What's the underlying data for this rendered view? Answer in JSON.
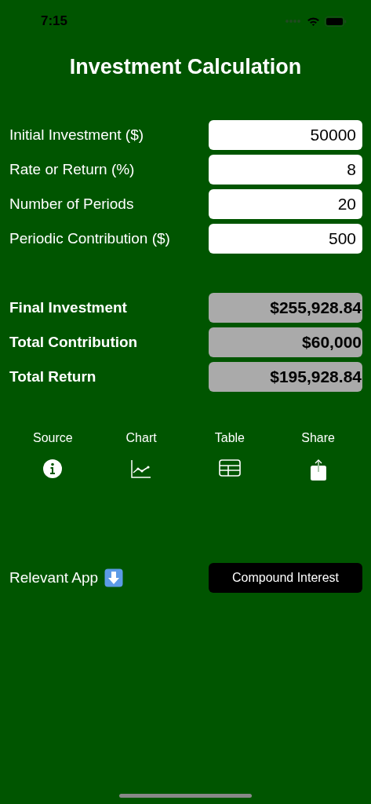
{
  "status_bar": {
    "time": "7:15"
  },
  "title": "Investment Calculation",
  "inputs": [
    {
      "label": "Initial Investment ($)",
      "value": "50000"
    },
    {
      "label": "Rate or Return (%)",
      "value": "8"
    },
    {
      "label": "Number of Periods",
      "value": "20"
    },
    {
      "label": "Periodic Contribution ($)",
      "value": "500"
    }
  ],
  "results": [
    {
      "label": "Final Investment",
      "value": "$255,928.84"
    },
    {
      "label": "Total Contribution",
      "value": "$60,000"
    },
    {
      "label": "Total Return",
      "value": "$195,928.84"
    }
  ],
  "actions": [
    {
      "label": "Source",
      "kind": "info"
    },
    {
      "label": "Chart",
      "kind": "chart"
    },
    {
      "label": "Table",
      "kind": "table"
    },
    {
      "label": "Share",
      "kind": "share"
    }
  ],
  "relevant_app": {
    "label": "Relevant App",
    "button": "Compound Interest"
  }
}
